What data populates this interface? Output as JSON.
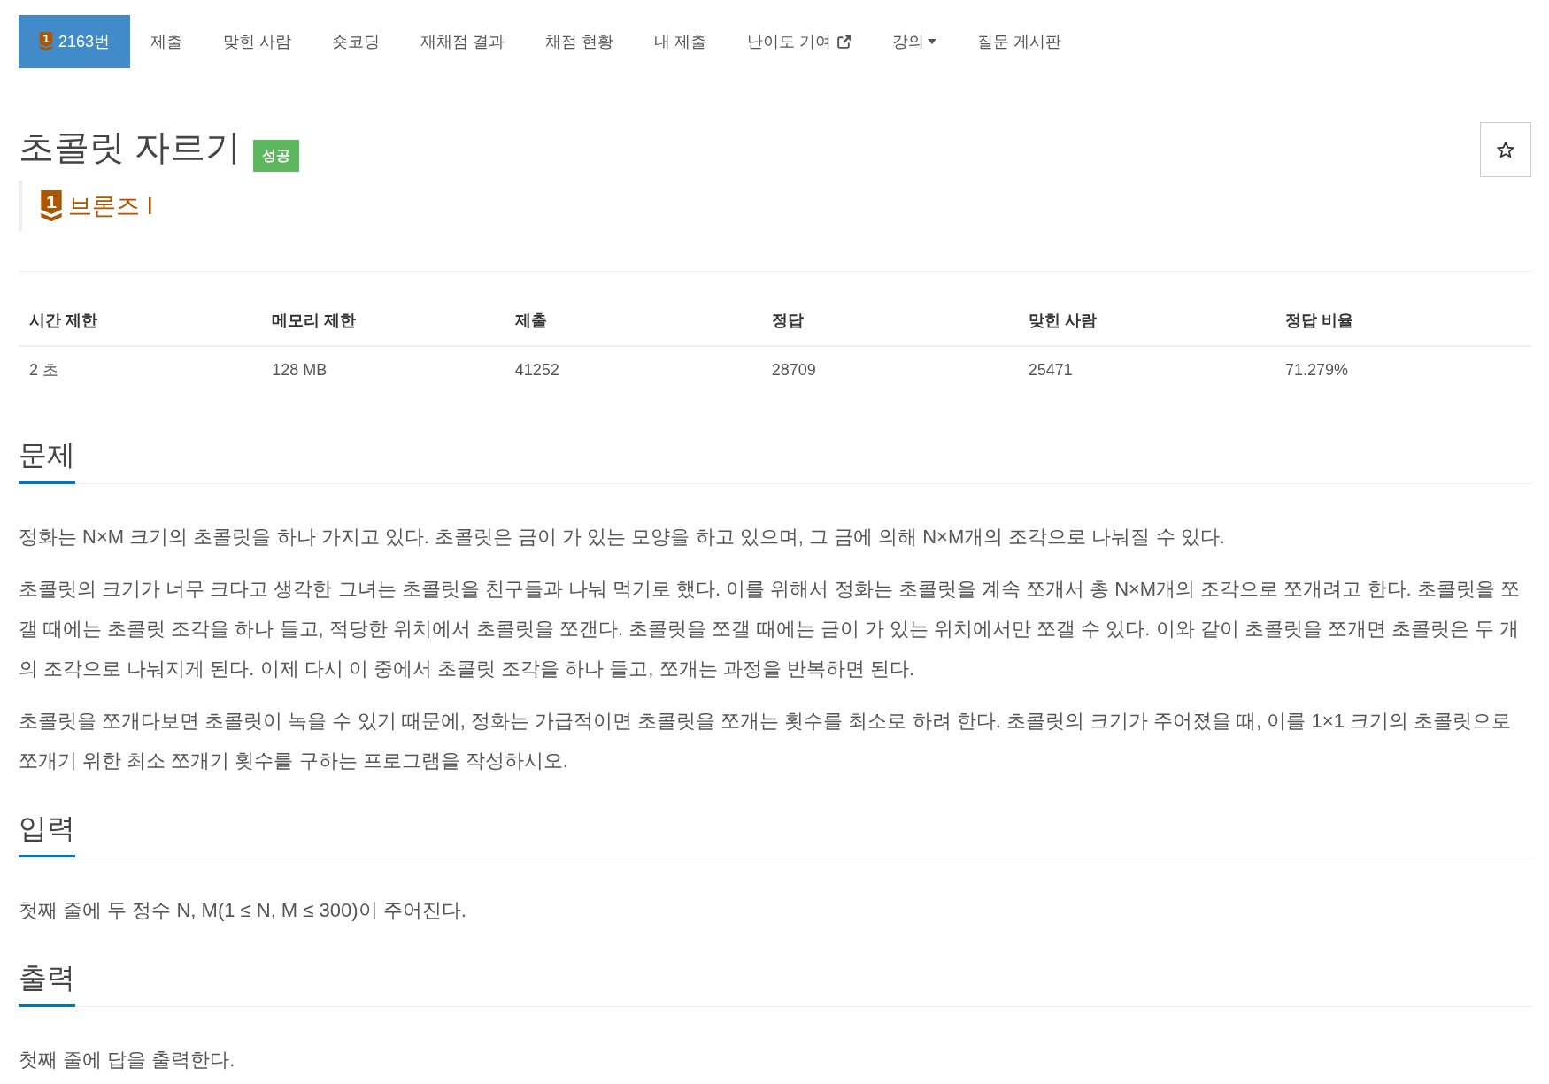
{
  "nav": [
    {
      "label": "2163번",
      "kind": "problem",
      "badge": "1",
      "selected": true
    },
    {
      "label": "제출",
      "kind": "link",
      "selected": false
    },
    {
      "label": "맞힌 사람",
      "kind": "link",
      "selected": false
    },
    {
      "label": "숏코딩",
      "kind": "link",
      "selected": false
    },
    {
      "label": "재채점 결과",
      "kind": "link",
      "selected": false
    },
    {
      "label": "채점 현황",
      "kind": "link",
      "selected": false
    },
    {
      "label": "내 제출",
      "kind": "link",
      "selected": false
    },
    {
      "label": "난이도 기여",
      "kind": "external",
      "selected": false
    },
    {
      "label": "강의",
      "kind": "dropdown",
      "selected": false
    },
    {
      "label": "질문 게시판",
      "kind": "link",
      "selected": false
    }
  ],
  "problem": {
    "title": "초콜릿 자르기",
    "result": "성공",
    "favorited": false,
    "tier": {
      "badge": "1",
      "label": "브론즈 I"
    }
  },
  "stats": {
    "columns": [
      "시간 제한",
      "메모리 제한",
      "제출",
      "정답",
      "맞힌 사람",
      "정답 비율"
    ],
    "rows": [
      [
        "2 초",
        "128 MB",
        "41252",
        "28709",
        "25471",
        "71.279%"
      ]
    ]
  },
  "sections": [
    {
      "title": "문제",
      "paragraphs": [
        "정화는 N×M 크기의 초콜릿을 하나 가지고 있다. 초콜릿은 금이 가 있는 모양을 하고 있으며, 그 금에 의해 N×M개의 조각으로 나눠질 수 있다.",
        "초콜릿의 크기가 너무 크다고 생각한 그녀는 초콜릿을 친구들과 나눠 먹기로 했다. 이를 위해서 정화는 초콜릿을 계속 쪼개서 총 N×M개의 조각으로 쪼개려고 한다. 초콜릿을 쪼갤 때에는 초콜릿 조각을 하나 들고, 적당한 위치에서 초콜릿을 쪼갠다. 초콜릿을 쪼갤 때에는 금이 가 있는 위치에서만 쪼갤 수 있다. 이와 같이 초콜릿을 쪼개면 초콜릿은 두 개의 조각으로 나눠지게 된다. 이제 다시 이 중에서 초콜릿 조각을 하나 들고, 쪼개는 과정을 반복하면 된다.",
        "초콜릿을 쪼개다보면 초콜릿이 녹을 수 있기 때문에, 정화는 가급적이면 초콜릿을 쪼개는 횟수를 최소로 하려 한다. 초콜릿의 크기가 주어졌을 때, 이를 1×1 크기의 초콜릿으로 쪼개기 위한 최소 쪼개기 횟수를 구하는 프로그램을 작성하시오."
      ]
    },
    {
      "title": "입력",
      "paragraphs": [
        "첫째 줄에 두 정수 N, M(1 ≤ N, M ≤ 300)이 주어진다."
      ]
    },
    {
      "title": "출력",
      "paragraphs": [
        "첫째 줄에 답을 출력한다."
      ]
    }
  ]
}
